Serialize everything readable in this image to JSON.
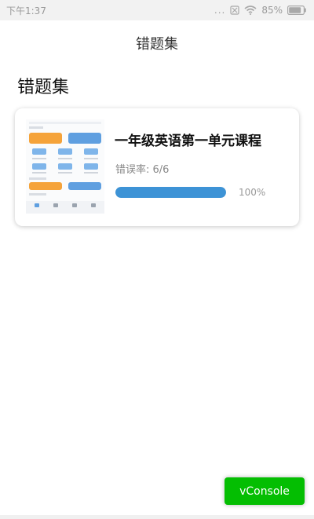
{
  "status_bar": {
    "time": "下午1:37",
    "dots": "...",
    "battery_percent": "85%",
    "battery_level": 0.85
  },
  "nav": {
    "title": "错题集"
  },
  "page": {
    "heading": "错题集"
  },
  "course": {
    "title": "一年级英语第一单元课程",
    "error_rate": "错误率: 6/6",
    "progress_text": "100%",
    "progress_value": 1.0
  },
  "vconsole": {
    "label": "vConsole"
  },
  "colors": {
    "progress": "#3d93d6",
    "vconsole": "#04be02"
  },
  "icons": {
    "status": [
      "no-sim-icon",
      "wifi-icon",
      "battery-icon"
    ]
  }
}
